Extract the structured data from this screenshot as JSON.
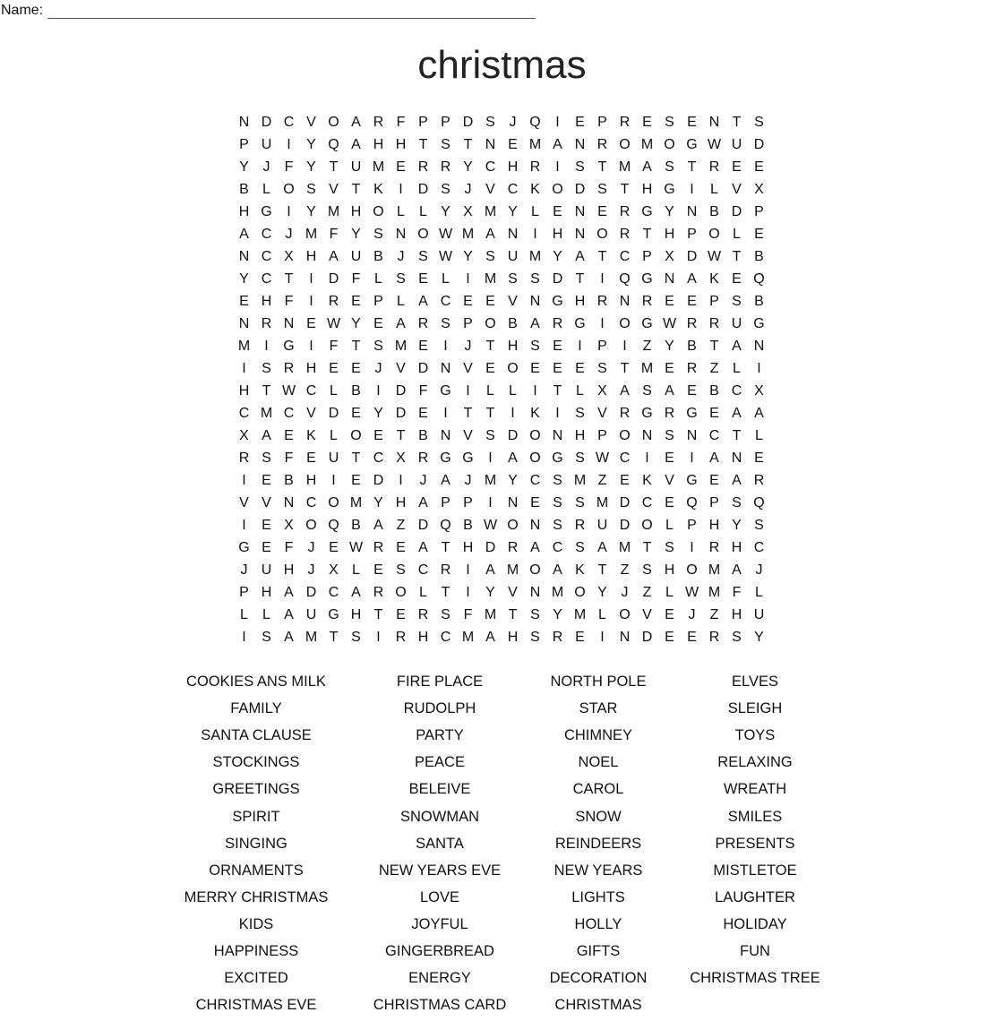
{
  "header": {
    "name_label": "Name:",
    "title": "christmas"
  },
  "grid": [
    [
      "N",
      "D",
      "C",
      "V",
      "O",
      "A",
      "R",
      "F",
      "P",
      "P",
      "D",
      "S",
      "J",
      "Q",
      "I",
      "E",
      "P",
      "R",
      "E",
      "S",
      "E",
      "N",
      "T",
      "S"
    ],
    [
      "P",
      "U",
      "I",
      "Y",
      "Q",
      "A",
      "H",
      "H",
      "T",
      "S",
      "T",
      "N",
      "E",
      "M",
      "A",
      "N",
      "R",
      "O",
      "M",
      "O",
      "G",
      "W",
      "U",
      "D"
    ],
    [
      "Y",
      "J",
      "F",
      "Y",
      "T",
      "U",
      "M",
      "E",
      "R",
      "R",
      "Y",
      "C",
      "H",
      "R",
      "I",
      "S",
      "T",
      "M",
      "A",
      "S",
      "T",
      "R",
      "E",
      "E"
    ],
    [
      "B",
      "L",
      "O",
      "S",
      "V",
      "T",
      "K",
      "I",
      "D",
      "S",
      "J",
      "V",
      "C",
      "K",
      "O",
      "D",
      "S",
      "T",
      "H",
      "G",
      "I",
      "L",
      "V",
      "X"
    ],
    [
      "H",
      "G",
      "I",
      "Y",
      "M",
      "H",
      "O",
      "L",
      "L",
      "Y",
      "X",
      "M",
      "Y",
      "L",
      "E",
      "N",
      "E",
      "R",
      "G",
      "Y",
      "N",
      "B",
      "D",
      "P"
    ],
    [
      "A",
      "C",
      "J",
      "M",
      "F",
      "Y",
      "S",
      "N",
      "O",
      "W",
      "M",
      "A",
      "N",
      "I",
      "H",
      "N",
      "O",
      "R",
      "T",
      "H",
      "P",
      "O",
      "L",
      "E"
    ],
    [
      "N",
      "C",
      "X",
      "H",
      "A",
      "U",
      "B",
      "J",
      "S",
      "W",
      "Y",
      "S",
      "U",
      "M",
      "Y",
      "A",
      "T",
      "C",
      "P",
      "X",
      "D",
      "W",
      "T",
      "B"
    ],
    [
      "Y",
      "C",
      "T",
      "I",
      "D",
      "F",
      "L",
      "S",
      "E",
      "L",
      "I",
      "M",
      "S",
      "S",
      "D",
      "T",
      "I",
      "Q",
      "G",
      "N",
      "A",
      "K",
      "E",
      "Q"
    ],
    [
      "E",
      "H",
      "F",
      "I",
      "R",
      "E",
      "P",
      "L",
      "A",
      "C",
      "E",
      "E",
      "V",
      "N",
      "G",
      "H",
      "R",
      "N",
      "R",
      "E",
      "E",
      "P",
      "S",
      "B"
    ],
    [
      "N",
      "R",
      "N",
      "E",
      "W",
      "Y",
      "E",
      "A",
      "R",
      "S",
      "P",
      "O",
      "B",
      "A",
      "R",
      "G",
      "I",
      "O",
      "G",
      "W",
      "R",
      "R",
      "U",
      "G"
    ],
    [
      "M",
      "I",
      "G",
      "I",
      "F",
      "T",
      "S",
      "M",
      "E",
      "I",
      "J",
      "T",
      "H",
      "S",
      "E",
      "I",
      "P",
      "I",
      "Z",
      "Y",
      "B",
      "T",
      "A",
      "N"
    ],
    [
      "I",
      "S",
      "R",
      "H",
      "E",
      "E",
      "J",
      "V",
      "D",
      "N",
      "V",
      "E",
      "O",
      "E",
      "E",
      "E",
      "S",
      "T",
      "M",
      "E",
      "R",
      "Z",
      "L",
      "I"
    ],
    [
      "H",
      "T",
      "W",
      "C",
      "L",
      "B",
      "I",
      "D",
      "F",
      "G",
      "I",
      "L",
      "L",
      "I",
      "T",
      "L",
      "X",
      "A",
      "S",
      "A",
      "E",
      "B",
      "C",
      "X"
    ],
    [
      "C",
      "M",
      "C",
      "V",
      "D",
      "E",
      "Y",
      "D",
      "E",
      "I",
      "T",
      "T",
      "I",
      "K",
      "I",
      "S",
      "V",
      "R",
      "G",
      "R",
      "G",
      "E",
      "A",
      "A"
    ],
    [
      "X",
      "A",
      "E",
      "K",
      "L",
      "O",
      "E",
      "T",
      "B",
      "N",
      "V",
      "S",
      "D",
      "O",
      "N",
      "H",
      "P",
      "O",
      "N",
      "S",
      "N",
      "C",
      "T",
      "L"
    ],
    [
      "R",
      "S",
      "F",
      "E",
      "U",
      "T",
      "C",
      "X",
      "R",
      "G",
      "G",
      "I",
      "A",
      "O",
      "G",
      "S",
      "W",
      "C",
      "I",
      "E",
      "I",
      "A",
      "N",
      "E"
    ],
    [
      "I",
      "E",
      "B",
      "H",
      "I",
      "E",
      "D",
      "I",
      "J",
      "A",
      "J",
      "M",
      "Y",
      "C",
      "S",
      "M",
      "Z",
      "E",
      "K",
      "V",
      "G",
      "E",
      "A",
      "R"
    ],
    [
      "V",
      "V",
      "N",
      "C",
      "O",
      "M",
      "Y",
      "H",
      "A",
      "P",
      "P",
      "I",
      "N",
      "E",
      "S",
      "S",
      "M",
      "D",
      "C",
      "E",
      "Q",
      "P",
      "S",
      "Q"
    ],
    [
      "I",
      "E",
      "X",
      "O",
      "Q",
      "B",
      "A",
      "Z",
      "D",
      "Q",
      "B",
      "W",
      "O",
      "N",
      "S",
      "R",
      "U",
      "D",
      "O",
      "L",
      "P",
      "H",
      "Y",
      "S"
    ],
    [
      "G",
      "E",
      "F",
      "J",
      "E",
      "W",
      "R",
      "E",
      "A",
      "T",
      "H",
      "D",
      "R",
      "A",
      "C",
      "S",
      "A",
      "M",
      "T",
      "S",
      "I",
      "R",
      "H",
      "C"
    ],
    [
      "J",
      "U",
      "H",
      "J",
      "X",
      "L",
      "E",
      "S",
      "C",
      "R",
      "I",
      "A",
      "M",
      "O",
      "A",
      "K",
      "T",
      "Z",
      "S",
      "H",
      "O",
      "M",
      "A",
      "J"
    ],
    [
      "P",
      "H",
      "A",
      "D",
      "C",
      "A",
      "R",
      "O",
      "L",
      "T",
      "I",
      "Y",
      "V",
      "N",
      "M",
      "O",
      "Y",
      "J",
      "Z",
      "L",
      "W",
      "M",
      "F",
      "L"
    ],
    [
      "L",
      "L",
      "A",
      "U",
      "G",
      "H",
      "T",
      "E",
      "R",
      "S",
      "F",
      "M",
      "T",
      "S",
      "Y",
      "M",
      "L",
      "O",
      "V",
      "E",
      "J",
      "Z",
      "H",
      "U"
    ],
    [
      "I",
      "S",
      "A",
      "M",
      "T",
      "S",
      "I",
      "R",
      "H",
      "C",
      "M",
      "A",
      "H",
      "S",
      "R",
      "E",
      "I",
      "N",
      "D",
      "E",
      "E",
      "R",
      "S",
      "Y"
    ]
  ],
  "word_columns": [
    [
      "COOKIES ANS MILK",
      "FAMILY",
      "SANTA CLAUSE",
      "STOCKINGS",
      "GREETINGS",
      "SPIRIT",
      "SINGING",
      "ORNAMENTS",
      "MERRY CHRISTMAS",
      "KIDS",
      "HAPPINESS",
      "EXCITED",
      "CHRISTMAS EVE"
    ],
    [
      "FIRE PLACE",
      "RUDOLPH",
      "PARTY",
      "PEACE",
      "BELEIVE",
      "SNOWMAN",
      "SANTA",
      "NEW YEARS EVE",
      "LOVE",
      "JOYFUL",
      "GINGERBREAD",
      "ENERGY",
      "CHRISTMAS CARD"
    ],
    [
      "NORTH POLE",
      "STAR",
      "CHIMNEY",
      "NOEL",
      "CAROL",
      "SNOW",
      "REINDEERS",
      "NEW YEARS",
      "LIGHTS",
      "HOLLY",
      "GIFTS",
      "DECORATION",
      "CHRISTMAS"
    ],
    [
      "ELVES",
      "SLEIGH",
      "TOYS",
      "RELAXING",
      "WREATH",
      "SMILES",
      "PRESENTS",
      "MISTLETOE",
      "LAUGHTER",
      "HOLIDAY",
      "FUN",
      "CHRISTMAS TREE"
    ]
  ]
}
